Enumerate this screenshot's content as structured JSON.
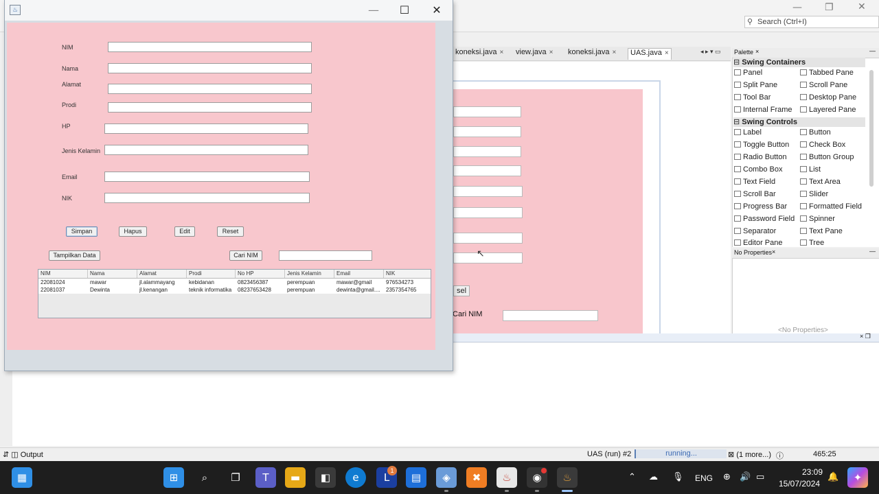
{
  "ide": {
    "search_placeholder": "Search (Ctrl+I)",
    "tabs": [
      {
        "label": "koneksi.java",
        "close": "×"
      },
      {
        "label": "view.java",
        "close": "×"
      },
      {
        "label": "koneksi.java",
        "close": "×"
      },
      {
        "label": "UAS.java",
        "close": "×"
      }
    ],
    "design_button_fragment": "sel",
    "design_cari_label": "Cari NIM",
    "palette": {
      "title": "Palette",
      "categories": [
        {
          "label": "Swing Containers",
          "items": [
            "Panel",
            "Tabbed Pane",
            "Split Pane",
            "Scroll Pane",
            "Tool Bar",
            "Desktop Pane",
            "Internal Frame",
            "Layered Pane"
          ]
        },
        {
          "label": "Swing Controls",
          "items": [
            "Label",
            "Button",
            "Toggle Button",
            "Check Box",
            "Radio Button",
            "Button Group",
            "Combo Box",
            "List",
            "Text Field",
            "Text Area",
            "Scroll Bar",
            "Slider",
            "Progress Bar",
            "Formatted Field",
            "Password Field",
            "Spinner",
            "Separator",
            "Text Pane",
            "Editor Pane",
            "Tree"
          ]
        }
      ]
    },
    "properties": {
      "title": "No Properties",
      "empty_text": "<No Properties>"
    },
    "output_title": "Output",
    "status": {
      "run_label": "UAS (run) #2",
      "progress_text": "running...",
      "more": "(1 more...)",
      "cursor": "465:25"
    }
  },
  "app": {
    "form": {
      "labels": [
        "NIM",
        "Nama",
        "Alamat",
        "Prodi",
        "HP",
        "Jenis Kelamin",
        "Email",
        "NIK"
      ]
    },
    "buttons": {
      "simpan": "Simpan",
      "hapus": "Hapus",
      "edit": "Edit",
      "reset": "Reset",
      "tampilkan": "Tampilkan Data",
      "cari": "Cari NIM"
    },
    "table": {
      "headers": [
        "NIM",
        "Nama",
        "Alamat",
        "Prodi",
        "No HP",
        "Jenis Kelamin",
        "Email",
        "NIK"
      ],
      "rows": [
        [
          "22081024",
          "mawar",
          "jl.alammayang",
          "kebidanan",
          "0823456387",
          "perempuan",
          "mawar@gmail",
          "976534273"
        ],
        [
          "22081037",
          "Dewinta",
          "jl.kenangan",
          "teknik informatika",
          "08237653428",
          "perempuan",
          "dewinta@gmail....",
          "2357354765"
        ]
      ]
    }
  },
  "taskbar": {
    "apps": [
      "start",
      "search",
      "task-view",
      "teams",
      "file-explorer",
      "store",
      "edge",
      "l-app",
      "calendar",
      "virtualbox",
      "xampp",
      "java",
      "obs",
      "java-app"
    ],
    "badge_count": "1",
    "language": "ENG",
    "time": "23:09",
    "date": "15/07/2024"
  },
  "colors": {
    "app_panel": "#f8c7cd",
    "taskbar": "#1e1e1e",
    "accent": "#3d6bb3"
  }
}
